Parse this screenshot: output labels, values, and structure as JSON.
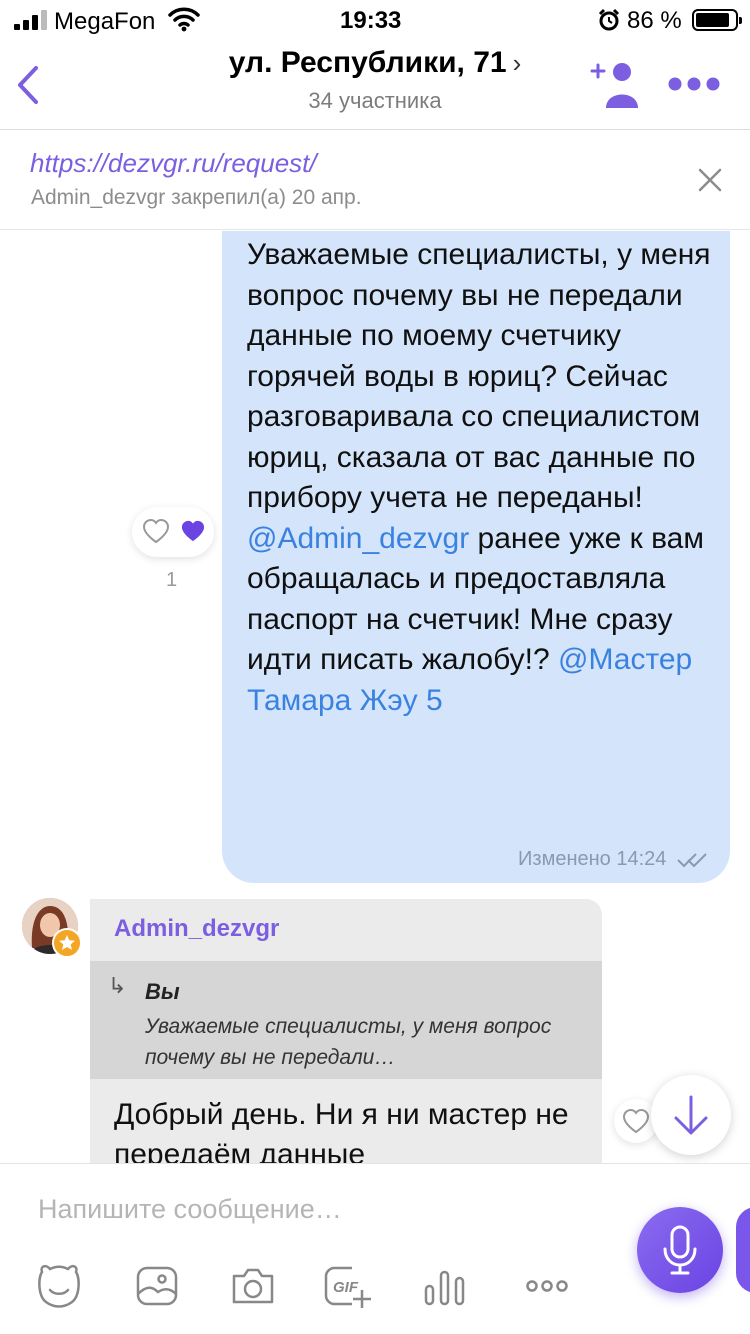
{
  "status_bar": {
    "carrier": "MegaFon",
    "time": "19:33",
    "battery_percent": "86 %",
    "battery_level": 0.86
  },
  "header": {
    "title": "ул. Республики, 71",
    "title_chevron": "›",
    "subtitle": "34 участника",
    "icons": [
      "back-chevron-icon",
      "add-participant-icon",
      "more-icon"
    ]
  },
  "pinned": {
    "link": "https://dezvgr.ru/request/",
    "meta": "Admin_dezvgr закрепил(а) 20 апр."
  },
  "outgoing_message": {
    "text_before_mention1": "Уважаемые специалисты, у меня вопрос почему вы не передали данные по моему счетчику горячей воды в юриц? Сейчас разговаривала со специалистом юриц, сказала от вас данные по прибору учета не переданы! ",
    "mention1": "@Admin_dezvgr",
    "text_between": " ранее уже к вам обращалась и предоставляла паспорт на счетчик! Мне сразу идти писать жалобу!? ",
    "mention2": "@Мастер Тамара Жэу 5",
    "edited_label": "Изменено",
    "time": "14:24",
    "reaction_count": "1"
  },
  "incoming_message": {
    "sender": "Admin_dezvgr",
    "quote_author": "Вы",
    "quote_text": "Уважаемые специалисты, у меня вопрос почему вы не передали…",
    "text": "Добрый день. Ни я ни мастер не передаём данные"
  },
  "composer": {
    "placeholder": "Напишите сообщение…",
    "toolbar": [
      "sticker-icon",
      "gallery-icon",
      "camera-icon",
      "gif-icon",
      "poll-icon",
      "more-options-icon"
    ],
    "gif_label": "GIF"
  },
  "colors": {
    "accent": "#7b5fe0",
    "outgoing_bubble": "#d4e5fb",
    "incoming_bubble": "#ebebeb",
    "mention": "#3a82e0"
  }
}
